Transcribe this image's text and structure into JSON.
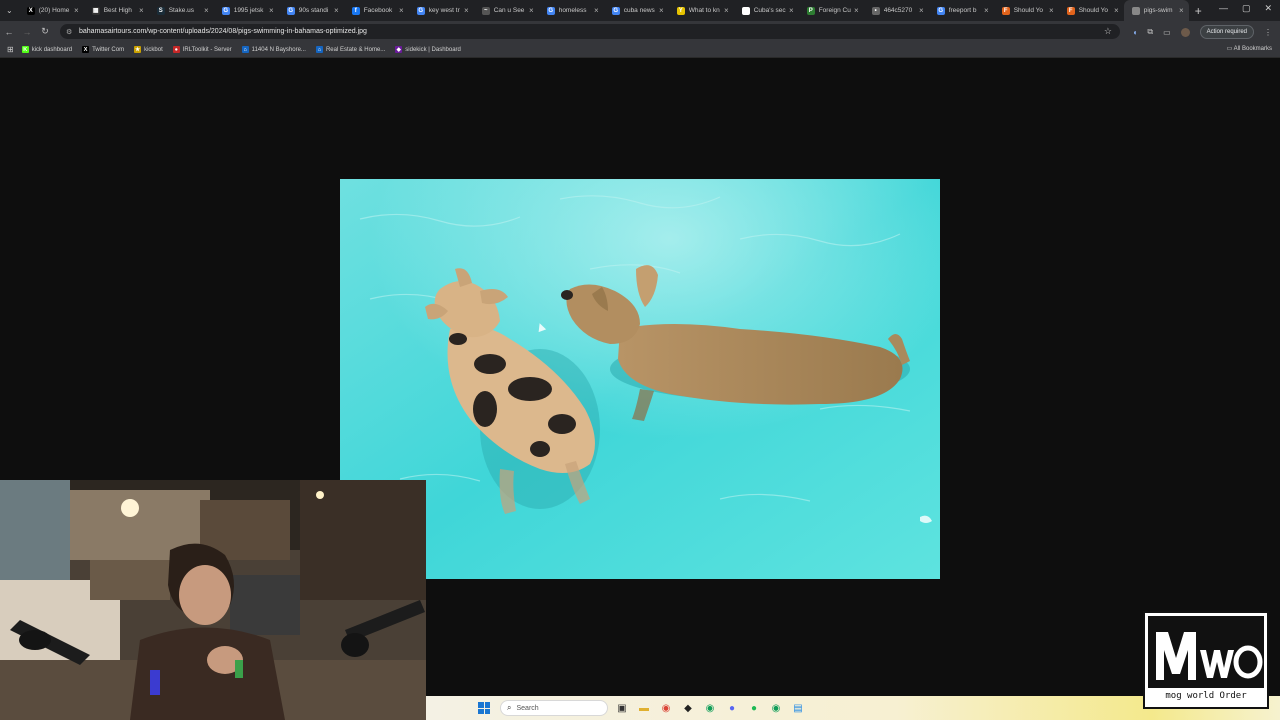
{
  "browser": {
    "tabs": [
      {
        "label": "(20) Home",
        "fav": "X",
        "color": "#000000"
      },
      {
        "label": "Best High",
        "fav": "▦",
        "color": "#333333"
      },
      {
        "label": "Stake.us",
        "fav": "S",
        "color": "#1a2c38"
      },
      {
        "label": "1995 jetsk",
        "fav": "G",
        "color": "#4285f4"
      },
      {
        "label": "90s standi",
        "fav": "G",
        "color": "#4285f4"
      },
      {
        "label": "Facebook",
        "fav": "f",
        "color": "#1877f2"
      },
      {
        "label": "key west tr",
        "fav": "G",
        "color": "#4285f4"
      },
      {
        "label": "Can u See",
        "fav": "~",
        "color": "#555555"
      },
      {
        "label": "homeless",
        "fav": "G",
        "color": "#4285f4"
      },
      {
        "label": "cuba news",
        "fav": "G",
        "color": "#4285f4"
      },
      {
        "label": "What to kn",
        "fav": "Y",
        "color": "#e6c300"
      },
      {
        "label": "Cuba's sec",
        "fav": "▭",
        "color": "#ffffff"
      },
      {
        "label": "Foreign Cu",
        "fav": "P",
        "color": "#2e7d32"
      },
      {
        "label": "464c5270",
        "fav": "•",
        "color": "#666666"
      },
      {
        "label": "freeport b",
        "fav": "G",
        "color": "#4285f4"
      },
      {
        "label": "Should Yo",
        "fav": "F",
        "color": "#e2631b"
      },
      {
        "label": "Should Yo",
        "fav": "F",
        "color": "#e2631b"
      },
      {
        "label": "pigs-swim",
        "fav": "",
        "color": "#888888",
        "active": true
      }
    ],
    "new_tab": "+",
    "window_controls": {
      "minimize": "—",
      "maximize": "▢",
      "close": "✕"
    },
    "url": "bahamasairtours.com/wp-content/uploads/2024/08/pigs-swimming-in-bahamas-optimized.jpg",
    "action_required": "Action required",
    "bookmarks": [
      {
        "label": "kick dashboard",
        "fav": "K",
        "color": "#53fc18"
      },
      {
        "label": "Twitter Com",
        "fav": "X",
        "color": "#000000"
      },
      {
        "label": "kickbot",
        "fav": "★",
        "color": "#c9a000"
      },
      {
        "label": "IRLToolkit - Server",
        "fav": "●",
        "color": "#c62828"
      },
      {
        "label": "11404 N Bayshore...",
        "fav": "⌂",
        "color": "#1565c0"
      },
      {
        "label": "Real Estate & Home...",
        "fav": "⌂",
        "color": "#1565c0"
      },
      {
        "label": "sidekick | Dashboard",
        "fav": "◆",
        "color": "#6a1b9a"
      }
    ],
    "all_bookmarks": "All Bookmarks"
  },
  "taskbar": {
    "search_placeholder": "Search"
  },
  "overlay": {
    "logo_text": "mWo",
    "logo_caption": "mog world Order"
  },
  "colors": {
    "water": "#3fd6d8",
    "water_light": "#8aeaea",
    "pig_spotted": "#d9b58a",
    "pig_spots": "#2a2420",
    "pig_tan": "#a98a5c",
    "viewer_bg": "#0e0e0e"
  }
}
